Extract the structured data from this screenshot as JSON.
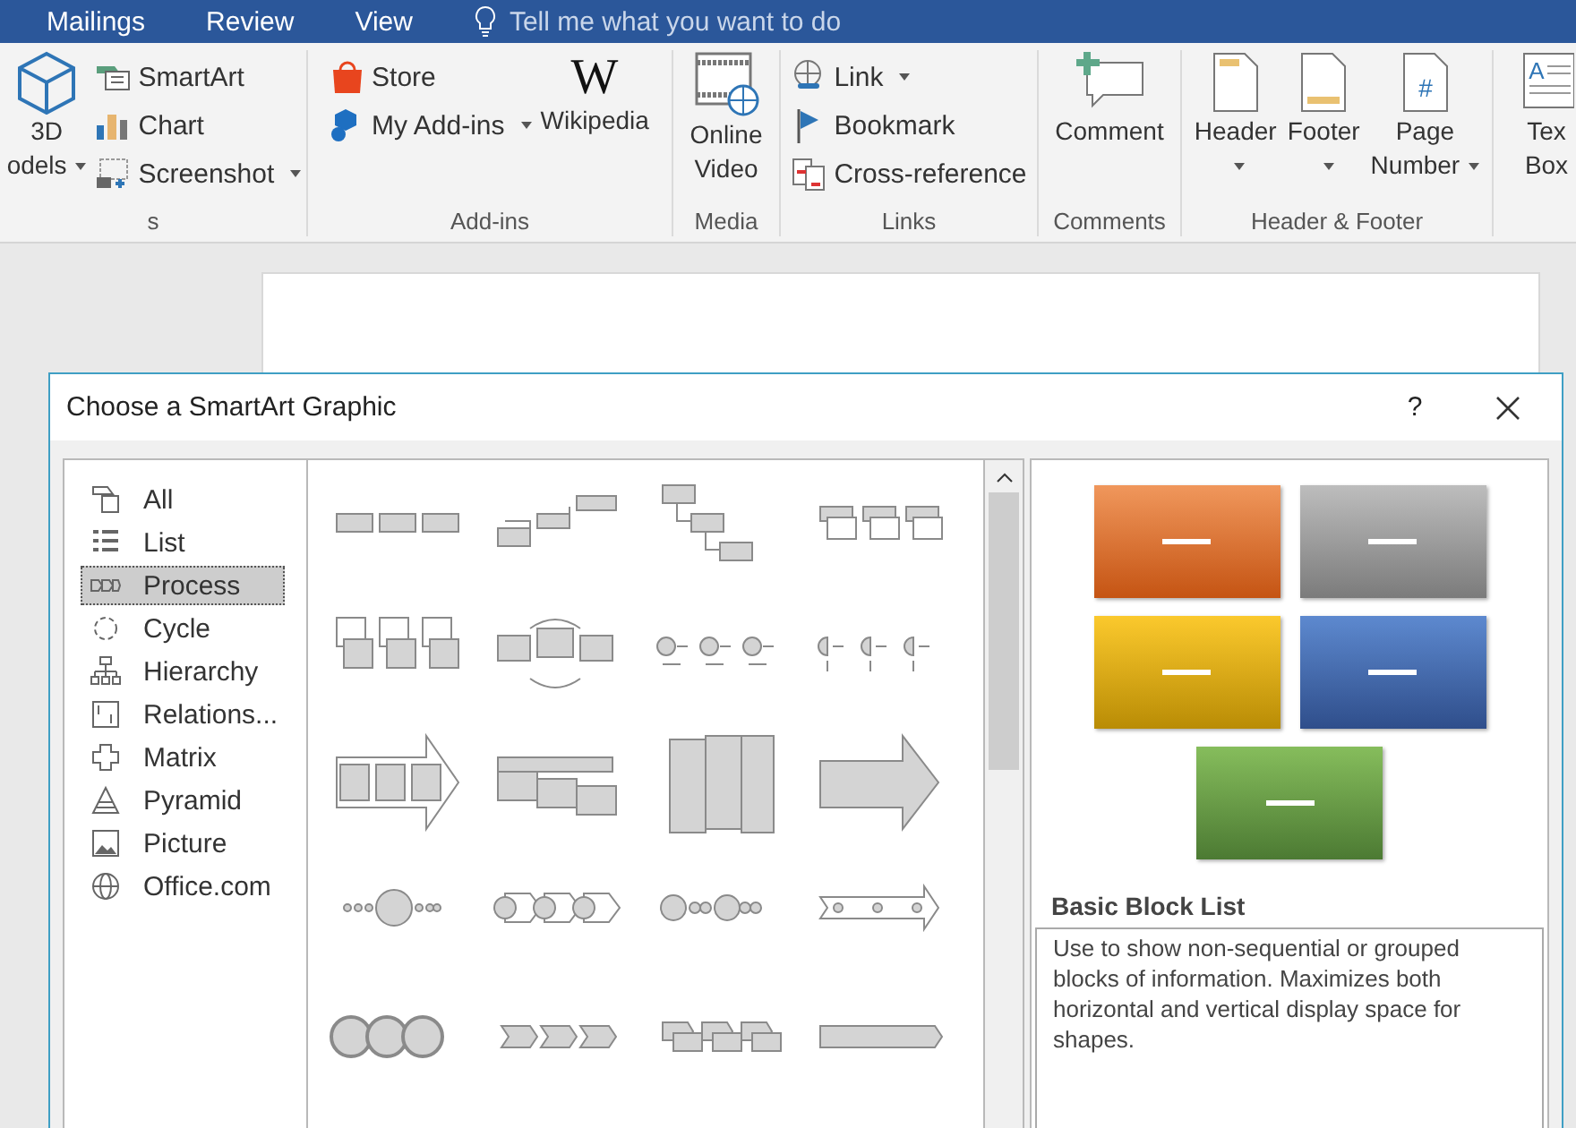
{
  "menu_tabs": [
    {
      "label": "Mailings"
    },
    {
      "label": "Review"
    },
    {
      "label": "View"
    }
  ],
  "tell_me": {
    "placeholder": "Tell me what you want to do"
  },
  "ribbon_groups": [
    {
      "label": "s",
      "columns": [
        {
          "kind": "large",
          "lines": [
            "3D",
            "odels"
          ],
          "dropdown": true
        },
        {
          "kind": "stack",
          "items": [
            {
              "label": "SmartArt",
              "dropdown": false
            },
            {
              "label": "Chart",
              "dropdown": false
            },
            {
              "label": "Screenshot",
              "dropdown": true
            }
          ]
        }
      ]
    },
    {
      "label": "Add-ins",
      "columns": [
        {
          "kind": "stack",
          "items": [
            {
              "label": "Store",
              "dropdown": false
            },
            {
              "label": "My Add-ins",
              "dropdown": true
            }
          ]
        },
        {
          "kind": "large",
          "lines": [
            "Wikipedia"
          ],
          "dropdown": false,
          "glyph": "W"
        }
      ]
    },
    {
      "label": "Media",
      "columns": [
        {
          "kind": "large",
          "lines": [
            "Online",
            "Video"
          ],
          "dropdown": false
        }
      ]
    },
    {
      "label": "Links",
      "columns": [
        {
          "kind": "stack",
          "items": [
            {
              "label": "Link",
              "dropdown": true
            },
            {
              "label": "Bookmark",
              "dropdown": false
            },
            {
              "label": "Cross-reference",
              "dropdown": false
            }
          ]
        }
      ]
    },
    {
      "label": "Comments",
      "columns": [
        {
          "kind": "large",
          "lines": [
            "Comment"
          ],
          "dropdown": false
        }
      ]
    },
    {
      "label": "Header & Footer",
      "columns": [
        {
          "kind": "large",
          "lines": [
            "Header"
          ],
          "dropdown": true
        },
        {
          "kind": "large",
          "lines": [
            "Footer"
          ],
          "dropdown": true
        },
        {
          "kind": "large",
          "lines": [
            "Page",
            "Number"
          ],
          "dropdown": true,
          "glyph": "#"
        }
      ]
    },
    {
      "columns": [
        {
          "kind": "large",
          "lines": [
            "Tex",
            "Box"
          ],
          "dropdown": false,
          "glyph": "A"
        }
      ]
    }
  ],
  "dialog": {
    "title": "Choose a SmartArt Graphic",
    "help": "?",
    "categories": [
      {
        "label": "All",
        "selected": false
      },
      {
        "label": "List",
        "selected": false
      },
      {
        "label": "Process",
        "selected": true
      },
      {
        "label": "Cycle",
        "selected": false
      },
      {
        "label": "Hierarchy",
        "selected": false
      },
      {
        "label": "Relations...",
        "selected": false
      },
      {
        "label": "Matrix",
        "selected": false
      },
      {
        "label": "Pyramid",
        "selected": false
      },
      {
        "label": "Picture",
        "selected": false
      },
      {
        "label": "Office.com",
        "selected": false
      }
    ],
    "preview_title": "Basic Block List",
    "description": "Use to show non-sequential or grouped blocks of information. Maximizes both horizontal and vertical display space for shapes."
  }
}
